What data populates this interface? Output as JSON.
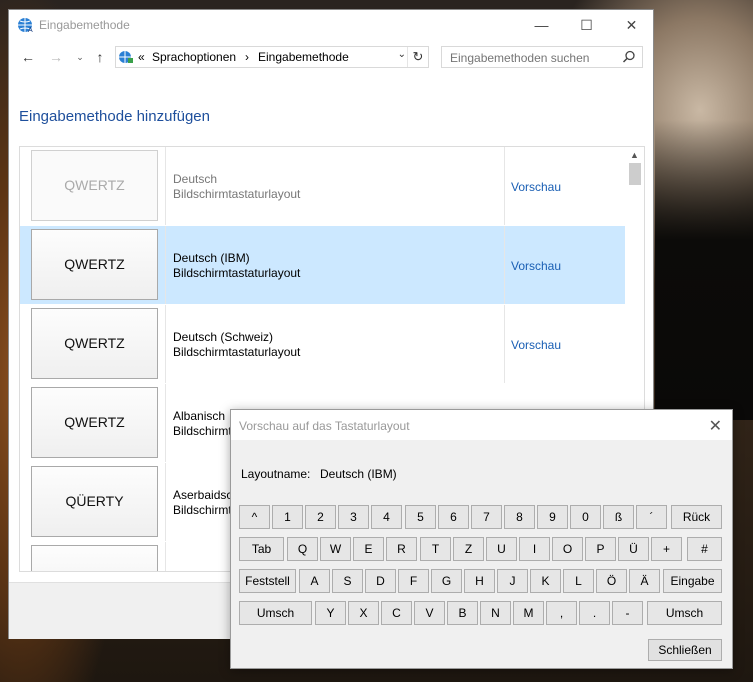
{
  "window": {
    "title": "Eingabemethode",
    "breadcrumb_prefix": "«",
    "breadcrumb": [
      "Sprachoptionen",
      "Eingabemethode"
    ],
    "breadcrumb_sep": "›",
    "search_placeholder": "Eingabemethoden suchen",
    "heading": "Eingabemethode hinzufügen"
  },
  "list": [
    {
      "key": "QWERTZ",
      "name": "Deutsch",
      "type": "Bildschirmtastaturlayout",
      "link": "Vorschau",
      "state": "faded"
    },
    {
      "key": "QWERTZ",
      "name": "Deutsch (IBM)",
      "type": "Bildschirmtastaturlayout",
      "link": "Vorschau",
      "state": "selected"
    },
    {
      "key": "QWERTZ",
      "name": "Deutsch (Schweiz)",
      "type": "Bildschirmtastaturlayout",
      "link": "Vorschau",
      "state": "normal"
    },
    {
      "key": "QWERTZ",
      "name": "Albanisch",
      "type": "Bildschirmt",
      "link": "",
      "state": "normal"
    },
    {
      "key": "QÜERTY",
      "name": "Aserbaidsch",
      "type": "Bildschirmt",
      "link": "",
      "state": "normal"
    },
    {
      "key": "",
      "name": "",
      "type": "",
      "link": "",
      "state": "normal"
    }
  ],
  "dialog": {
    "title": "Vorschau auf das Tastaturlayout",
    "layout_label": "Layoutname:",
    "layout_value": "Deutsch (IBM)",
    "close_label": "Schließen",
    "keyboard": {
      "row1": [
        "^",
        "1",
        "2",
        "3",
        "4",
        "5",
        "6",
        "7",
        "8",
        "9",
        "0",
        "ß",
        "´",
        "Rück"
      ],
      "row2": [
        "Tab",
        "Q",
        "W",
        "E",
        "R",
        "T",
        "Z",
        "U",
        "I",
        "O",
        "P",
        "Ü",
        "+",
        "#"
      ],
      "row3": [
        "Feststell",
        "A",
        "S",
        "D",
        "F",
        "G",
        "H",
        "J",
        "K",
        "L",
        "Ö",
        "Ä",
        "Eingabe"
      ],
      "row4": [
        "Umsch",
        "Y",
        "X",
        "C",
        "V",
        "B",
        "N",
        "M",
        ",",
        ".",
        "-",
        "Umsch"
      ]
    }
  },
  "colors": {
    "heading": "#1e4f9c",
    "link": "#1a5fb4",
    "selected_row": "#cce8ff"
  }
}
